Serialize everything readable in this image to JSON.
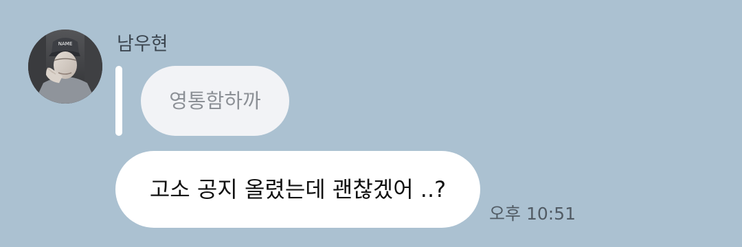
{
  "chat": {
    "sender_name": "남우현",
    "quoted_message": "영통함하까",
    "message_text": "고소 공지 올렸는데 괜찮겠어 ..?",
    "timestamp": "오후 10:51"
  },
  "icons": {
    "avatar": "profile-photo",
    "avatar_cap_text": "NAME"
  },
  "colors": {
    "background": "#abc1d1",
    "message_bubble": "#ffffff",
    "quote_bubble": "#f2f3f6",
    "quote_bar": "#ffffff",
    "message_text": "#111111",
    "quote_text": "#8c9096",
    "timestamp_text": "#515b64",
    "sender_text": "#3c4650"
  }
}
